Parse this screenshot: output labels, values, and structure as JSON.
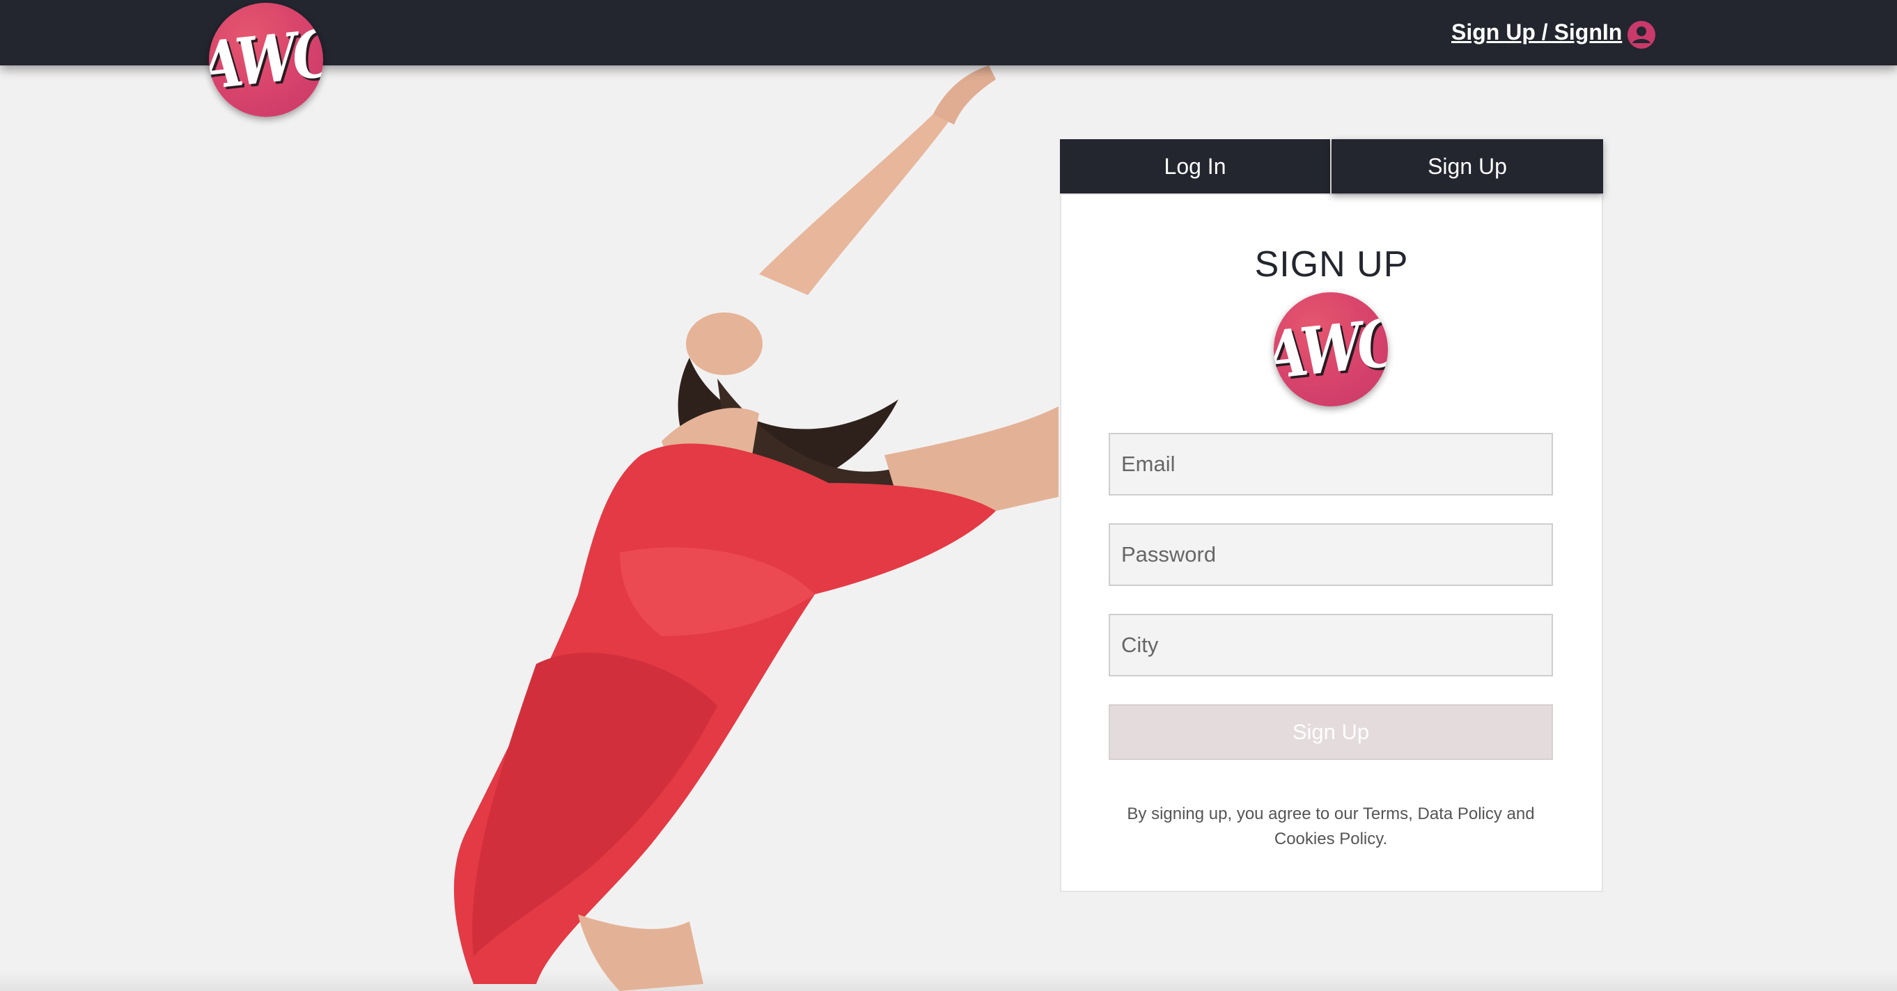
{
  "header": {
    "logo_text": "AWC",
    "auth_link": "Sign Up / SignIn",
    "user_icon": "user-circle-icon"
  },
  "tabs": [
    {
      "label": "Log In"
    },
    {
      "label": "Sign Up"
    }
  ],
  "form": {
    "title": "SIGN UP",
    "logo_text": "AWC",
    "email_placeholder": "Email",
    "password_placeholder": "Password",
    "city_placeholder": "City",
    "submit_label": "Sign Up",
    "terms": "By signing up, you agree to our Terms, Data Policy and Cookies Policy."
  },
  "colors": {
    "header_bg": "#23252f",
    "brand_pink": "#d9456b",
    "dress_red": "#e33a45",
    "page_bg": "#f2f1f1"
  }
}
